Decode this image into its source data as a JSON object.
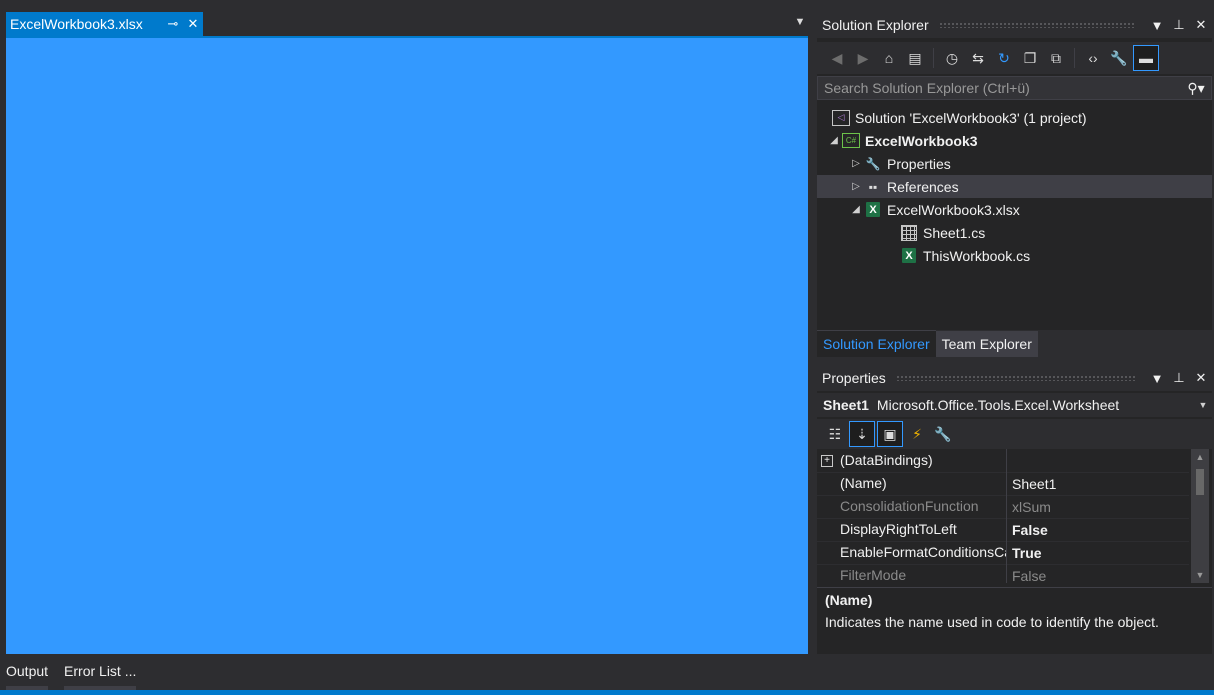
{
  "document": {
    "tab_label": "ExcelWorkbook3.xlsx",
    "pin_icon": "pin-icon",
    "close_icon": "close-icon",
    "canvas_color": "#3399ff",
    "accent_color": "#007acc"
  },
  "solution_explorer": {
    "title": "Solution Explorer",
    "search_placeholder": "Search Solution Explorer (Ctrl+ü)",
    "toolbar": [
      "back-icon",
      "forward-icon",
      "home-icon",
      "switch-views-icon",
      "pending-changes-icon",
      "sync-icon",
      "refresh-icon",
      "collapse-all-icon",
      "show-all-files-icon",
      "view-code-icon",
      "properties-icon",
      "preview-selected-icon"
    ],
    "tree": [
      {
        "label": "Solution 'ExcelWorkbook3' (1 project)",
        "icon": "solution-icon"
      },
      {
        "label": "ExcelWorkbook3",
        "icon": "project-icon",
        "expanded": true
      },
      {
        "label": "Properties",
        "icon": "wrench-icon",
        "expanded": false
      },
      {
        "label": "References",
        "icon": "references-icon",
        "expanded": false,
        "selected": true
      },
      {
        "label": "ExcelWorkbook3.xlsx",
        "icon": "excel-icon",
        "expanded": true
      },
      {
        "label": "Sheet1.cs",
        "icon": "sheet-icon"
      },
      {
        "label": "ThisWorkbook.cs",
        "icon": "excel-icon"
      }
    ],
    "tabs": [
      "Solution Explorer",
      "Team Explorer"
    ]
  },
  "properties": {
    "title": "Properties",
    "object_name": "Sheet1",
    "object_type": "Microsoft.Office.Tools.Excel.Worksheet",
    "toolbar": [
      "categorized-icon",
      "alphabetical-icon",
      "properties-page-icon",
      "events-icon",
      "property-pages-icon"
    ],
    "rows": [
      {
        "name": "(DataBindings)",
        "value": "",
        "expandable": true
      },
      {
        "name": "(Name)",
        "value": "Sheet1"
      },
      {
        "name": "ConsolidationFunction",
        "value": "xlSum",
        "dim": true
      },
      {
        "name": "DisplayRightToLeft",
        "value": "False",
        "bold": true
      },
      {
        "name": "EnableFormatConditionsCalculation",
        "value": "True",
        "bold": true
      },
      {
        "name": "FilterMode",
        "value": "False",
        "dim": true
      }
    ],
    "description_title": "(Name)",
    "description_text": "Indicates the name used in code to identify the object."
  },
  "bottom_tabs": [
    "Output",
    "Error List ..."
  ]
}
